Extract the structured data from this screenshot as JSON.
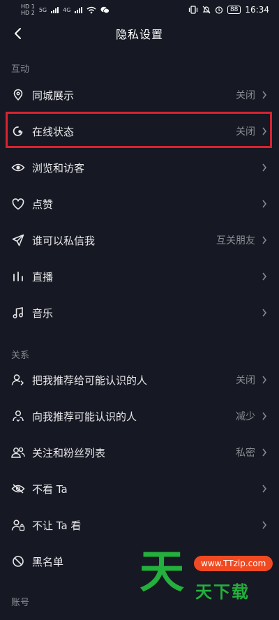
{
  "status_bar": {
    "sim1": "HD 1",
    "sim2": "HD 2",
    "net1": "5G",
    "net2": "4G",
    "battery": "88",
    "time": "16:34"
  },
  "header": {
    "title": "隐私设置"
  },
  "sections": [
    {
      "title": "互动",
      "items": [
        {
          "label": "同城展示",
          "value": "关闭",
          "icon": "location-pin-icon"
        },
        {
          "label": "在线状态",
          "value": "关闭",
          "icon": "online-status-icon"
        },
        {
          "label": "浏览和访客",
          "value": "",
          "icon": "eye-icon"
        },
        {
          "label": "点赞",
          "value": "",
          "icon": "heart-icon"
        },
        {
          "label": "谁可以私信我",
          "value": "互关朋友",
          "icon": "paper-plane-icon"
        },
        {
          "label": "直播",
          "value": "",
          "icon": "live-bars-icon"
        },
        {
          "label": "音乐",
          "value": "",
          "icon": "music-note-icon"
        }
      ]
    },
    {
      "title": "关系",
      "items": [
        {
          "label": "把我推荐给可能认识的人",
          "value": "关闭",
          "icon": "recommend-me-icon"
        },
        {
          "label": "向我推荐可能认识的人",
          "value": "减少",
          "icon": "recommend-to-me-icon"
        },
        {
          "label": "关注和粉丝列表",
          "value": "私密",
          "icon": "followers-icon"
        },
        {
          "label": "不看 Ta",
          "value": "",
          "icon": "eye-off-icon"
        },
        {
          "label": "不让 Ta 看",
          "value": "",
          "icon": "user-lock-icon"
        },
        {
          "label": "黑名单",
          "value": "",
          "icon": "block-icon"
        }
      ]
    },
    {
      "title": "账号",
      "items": []
    }
  ],
  "watermark": {
    "glyph": "天",
    "url": "www.TTzip.com",
    "text": "天下载"
  },
  "colors": {
    "background": "#161823",
    "text": "#e8e8ea",
    "muted": "#8a8b91",
    "highlight": "#d8232f"
  }
}
